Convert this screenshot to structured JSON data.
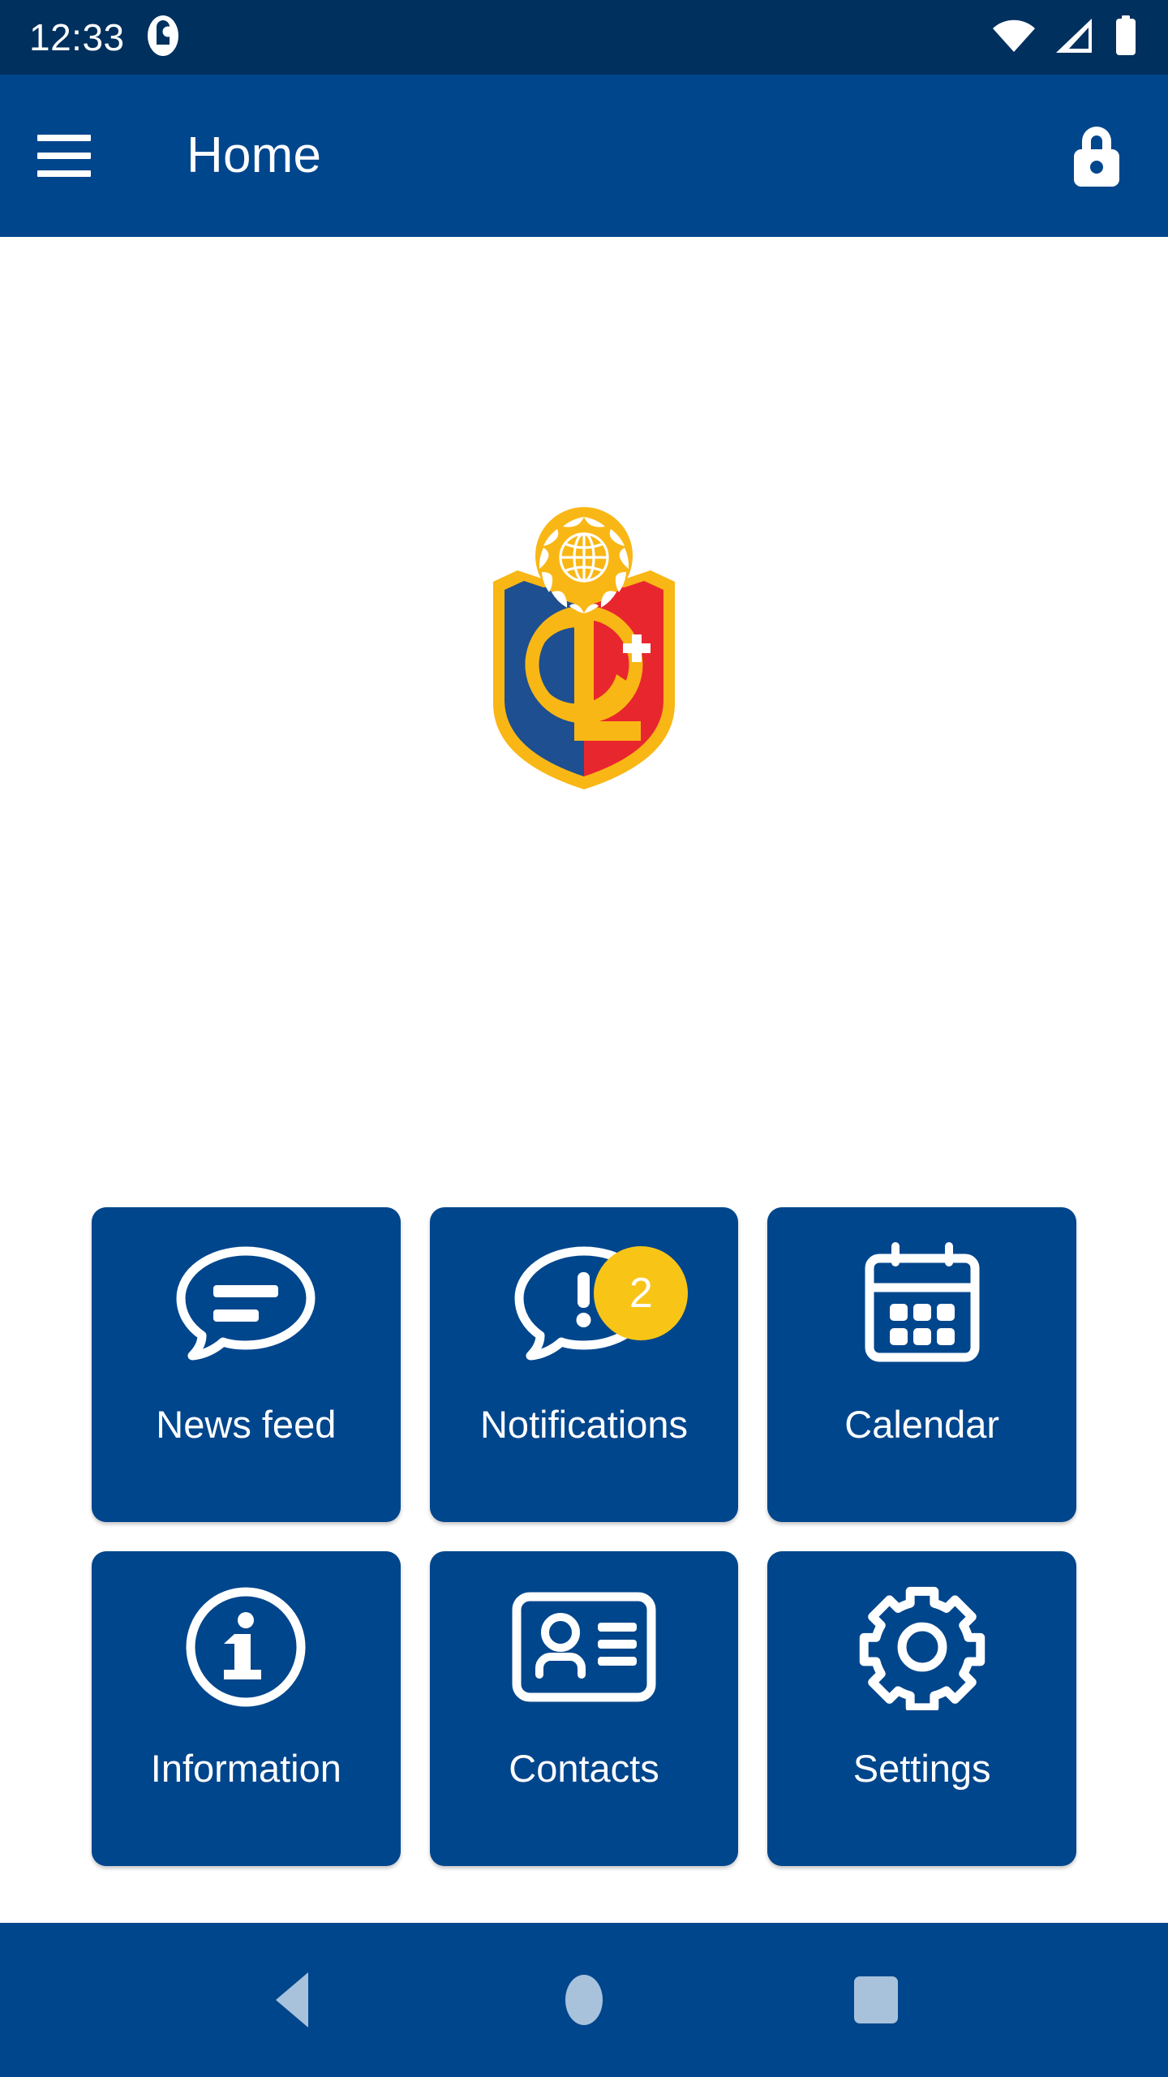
{
  "status_bar": {
    "time": "12:33",
    "left_icon": "app-notification-icon",
    "icons": [
      "wifi-icon",
      "cellular-signal-icon",
      "battery-icon"
    ],
    "background": "#00305e"
  },
  "app_bar": {
    "menu_icon": "hamburger-menu-icon",
    "title": "Home",
    "lock_icon": "lock-closed-icon",
    "background": "#00468c"
  },
  "logo": {
    "name": "organization-crest-logo",
    "monogram": "CL",
    "cross": "+",
    "colors": {
      "gold": "#f9b715",
      "blue": "#1d4f91",
      "red": "#e8262e",
      "white": "#ffffff"
    }
  },
  "tiles": [
    {
      "id": "news-feed",
      "label": "News feed",
      "icon": "chat-bubble-lines-icon"
    },
    {
      "id": "notifications",
      "label": "Notifications",
      "icon": "chat-bubble-alert-icon",
      "badge": "2"
    },
    {
      "id": "calendar",
      "label": "Calendar",
      "icon": "calendar-icon"
    },
    {
      "id": "information",
      "label": "Information",
      "icon": "info-circle-icon"
    },
    {
      "id": "contacts",
      "label": "Contacts",
      "icon": "id-card-person-icon"
    },
    {
      "id": "settings",
      "label": "Settings",
      "icon": "gear-icon"
    }
  ],
  "theme": {
    "tile_background": "#00468c",
    "badge_background": "#f8c517",
    "badge_text": "#ffffff",
    "page_background": "#ffffff",
    "nav_icon": "#a8c2dc"
  },
  "nav_bar": {
    "back": "back-triangle-icon",
    "home": "home-circle-icon",
    "recents": "recents-square-icon",
    "background": "#00468c"
  }
}
